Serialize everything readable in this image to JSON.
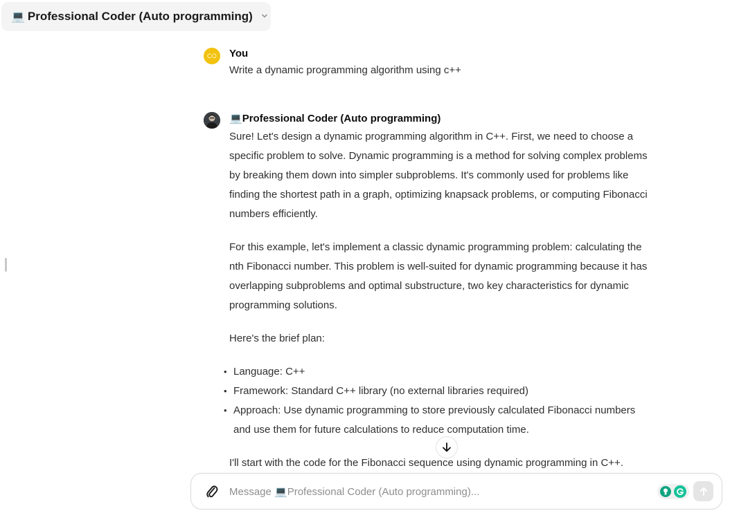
{
  "header": {
    "model_emoji": "💻",
    "model_name": "Professional Coder (Auto programming)"
  },
  "conversation": {
    "user": {
      "avatar_initials": "CO",
      "name": "You",
      "text": "Write a dynamic programming algorithm using c++"
    },
    "assistant": {
      "emoji": "💻",
      "name": "Professional Coder (Auto programming)",
      "paragraphs": [
        "Sure! Let's design a dynamic programming algorithm in C++. First, we need to choose a specific problem to solve. Dynamic programming is a method for solving complex problems by breaking them down into simpler subproblems. It's commonly used for problems like finding the shortest path in a graph, optimizing knapsack problems, or computing Fibonacci numbers efficiently.",
        "For this example, let's implement a classic dynamic programming problem: calculating the nth Fibonacci number. This problem is well-suited for dynamic programming because it has overlapping subproblems and optimal substructure, two key characteristics for dynamic programming solutions.",
        "Here's the brief plan:"
      ],
      "plan": [
        "Language: C++",
        "Framework: Standard C++ library (no external libraries required)",
        "Approach: Use dynamic programming to store previously calculated Fibonacci numbers and use them for future calculations to reduce computation time."
      ],
      "closing": "I'll start with the code for the Fibonacci sequence using dynamic programming in C++."
    }
  },
  "composer": {
    "placeholder": "Message 💻Professional Coder (Auto programming)..."
  },
  "icons": {
    "chevron": "chevron-down-icon",
    "scroll_down": "arrow-down-icon",
    "attach": "paperclip-icon",
    "send": "arrow-up-icon"
  },
  "colors": {
    "user_avatar": "#f2c20f",
    "grammarly": "#15c39a",
    "send_disabled": "#e5e5e5"
  }
}
